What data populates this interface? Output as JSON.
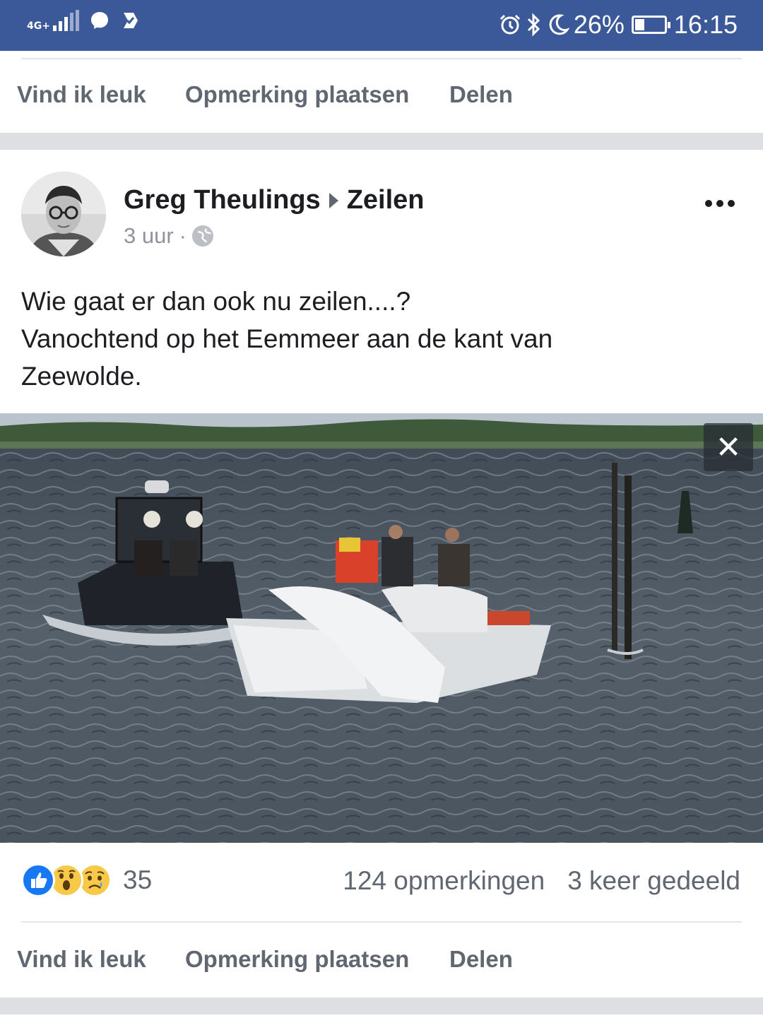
{
  "status_bar": {
    "network": "4G+",
    "battery": "26%",
    "time": "16:15",
    "battery_level": 0.26
  },
  "actions_top": {
    "like": "Vind ik leuk",
    "comment": "Opmerking plaatsen",
    "share": "Delen"
  },
  "post": {
    "author": "Greg Theulings",
    "group": "Zeilen",
    "time": "3 uur",
    "separator": "·",
    "text_lines": [
      "Wie gaat er dan ook nu zeilen....?",
      "Vanochtend op het Eemmeer aan de kant van",
      "Zeewolde."
    ],
    "close_glyph": "✕",
    "reaction_count": "35",
    "comments": "124 opmerkingen",
    "shares": "3 keer gedeeld",
    "reaction_icons": [
      "like-icon",
      "wow-icon",
      "sad-icon"
    ]
  },
  "actions_bottom": {
    "like": "Vind ik leuk",
    "comment": "Opmerking plaatsen",
    "share": "Delen"
  },
  "colors": {
    "status_bar": "#3b5998",
    "action_text": "#606770",
    "like_blue": "#1877f2",
    "emoji_yellow": "#f7c948"
  }
}
